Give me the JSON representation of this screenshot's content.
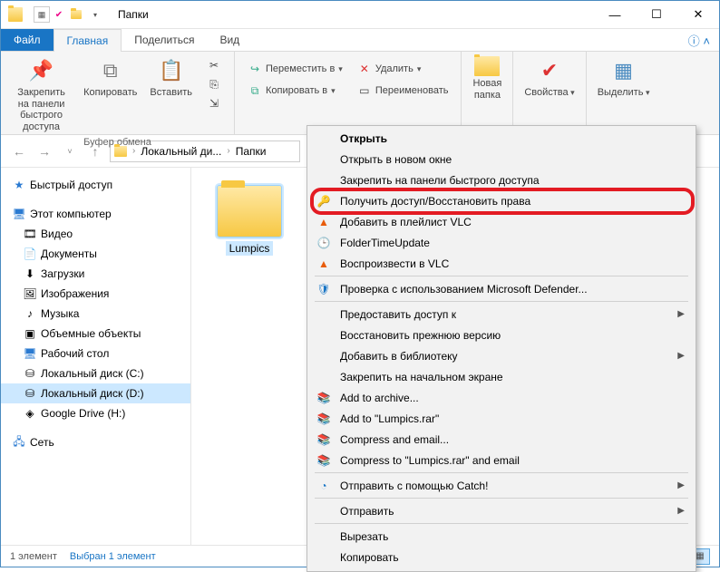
{
  "title": "Папки",
  "tabs": {
    "file": "Файл",
    "home": "Главная",
    "share": "Поделиться",
    "view": "Вид"
  },
  "ribbon": {
    "pin": "Закрепить на панели\nбыстрого доступа",
    "copy": "Копировать",
    "paste": "Вставить",
    "clipboard_label": "Буфер обмена",
    "moveTo": "Переместить в",
    "copyTo": "Копировать в",
    "delete": "Удалить",
    "rename": "Переименовать",
    "newFolder": "Новая\nпапка",
    "properties": "Свойства",
    "select": "Выделить"
  },
  "breadcrumb": {
    "disk": "Локальный ди...",
    "folder": "Папки"
  },
  "sidebar": {
    "quick": "Быстрый доступ",
    "pc": "Этот компьютер",
    "items": [
      "Видео",
      "Документы",
      "Загрузки",
      "Изображения",
      "Музыка",
      "Объемные объекты",
      "Рабочий стол",
      "Локальный диск (C:)",
      "Локальный диск (D:)",
      "Google Drive (H:)"
    ],
    "network": "Сеть"
  },
  "folder_item": "Lumpics",
  "status": {
    "count": "1 элемент",
    "selected": "Выбран 1 элемент"
  },
  "ctx": {
    "open": "Открыть",
    "openNew": "Открыть в новом окне",
    "pinQuick": "Закрепить на панели быстрого доступа",
    "takeOwn": "Получить доступ/Восстановить права",
    "addVlc": "Добавить в плейлист VLC",
    "ftu": "FolderTimeUpdate",
    "playVlc": "Воспроизвести в VLC",
    "defender": "Проверка с использованием Microsoft Defender...",
    "giveAccess": "Предоставить доступ к",
    "restorePrev": "Восстановить прежнюю версию",
    "addLib": "Добавить в библиотеку",
    "pinStart": "Закрепить на начальном экране",
    "addArchive": "Add to archive...",
    "addRar": "Add to \"Lumpics.rar\"",
    "compEmail": "Compress and email...",
    "compRarEmail": "Compress to \"Lumpics.rar\" and email",
    "sendCatch": "Отправить с помощью Catch!",
    "send": "Отправить",
    "cut": "Вырезать",
    "copy": "Копировать"
  }
}
